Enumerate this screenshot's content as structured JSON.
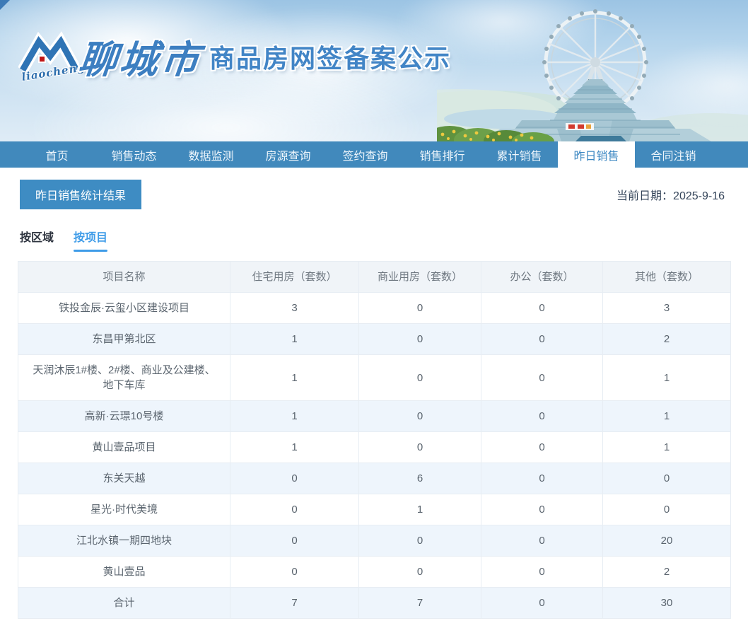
{
  "banner": {
    "logo_text": "liaocheng",
    "city_name": "聊城市",
    "site_title": "商品房网签备案公示"
  },
  "nav": {
    "items": [
      {
        "label": "首页",
        "active": false
      },
      {
        "label": "销售动态",
        "active": false
      },
      {
        "label": "数据监测",
        "active": false
      },
      {
        "label": "房源查询",
        "active": false
      },
      {
        "label": "签约查询",
        "active": false
      },
      {
        "label": "销售排行",
        "active": false
      },
      {
        "label": "累计销售",
        "active": false
      },
      {
        "label": "昨日销售",
        "active": true
      },
      {
        "label": "合同注销",
        "active": false
      }
    ]
  },
  "toolbar": {
    "result_button_label": "昨日销售统计结果",
    "current_date_label": "当前日期：",
    "current_date_value": "2025-9-16"
  },
  "tabs": [
    {
      "label": "按区域",
      "active": false
    },
    {
      "label": "按项目",
      "active": true
    }
  ],
  "table": {
    "headers": [
      "项目名称",
      "住宅用房（套数）",
      "商业用房（套数）",
      "办公（套数）",
      "其他（套数）"
    ],
    "rows": [
      {
        "name": "铁投金辰·云玺小区建设项目",
        "values": [
          "3",
          "0",
          "0",
          "3"
        ]
      },
      {
        "name": "东昌甲第北区",
        "values": [
          "1",
          "0",
          "0",
          "2"
        ]
      },
      {
        "name": "天润沐辰1#楼、2#楼、商业及公建楼、地下车库",
        "values": [
          "1",
          "0",
          "0",
          "1"
        ]
      },
      {
        "name": "高新·云璟10号楼",
        "values": [
          "1",
          "0",
          "0",
          "1"
        ]
      },
      {
        "name": "黄山壹品项目",
        "values": [
          "1",
          "0",
          "0",
          "1"
        ]
      },
      {
        "name": "东关天越",
        "values": [
          "0",
          "6",
          "0",
          "0"
        ]
      },
      {
        "name": "星光·时代美境",
        "values": [
          "0",
          "1",
          "0",
          "0"
        ]
      },
      {
        "name": "江北水镇一期四地块",
        "values": [
          "0",
          "0",
          "0",
          "20"
        ]
      },
      {
        "name": "黄山壹品",
        "values": [
          "0",
          "0",
          "0",
          "2"
        ]
      },
      {
        "name": "合计",
        "values": [
          "7",
          "7",
          "0",
          "30"
        ]
      }
    ]
  },
  "colors": {
    "nav_blue": "#4189bc",
    "button_blue": "#3e8cc3",
    "tab_active_blue": "#3f9ce8",
    "stripe_blue": "#eef5fc",
    "header_bg": "#f0f4f8",
    "border_col": "#e7edf3",
    "title_blue": "#4285c6"
  }
}
